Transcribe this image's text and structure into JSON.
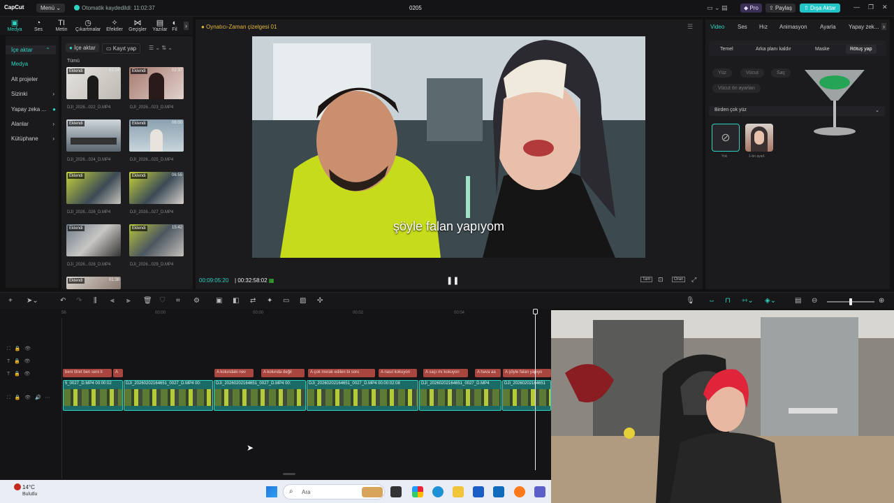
{
  "app": {
    "logo": "CapCut",
    "menu_label": "Menü",
    "autosave_text": "Otomatik kaydedildi: 11:02:37",
    "project_title": "0205",
    "pro_label": "Pro",
    "share_label": "Paylaş",
    "export_label": "Dışa Aktar"
  },
  "tools": [
    {
      "label": "Medya",
      "icon": "media-icon"
    },
    {
      "label": "Ses",
      "icon": "audio-icon"
    },
    {
      "label": "Metin",
      "icon": "text-icon"
    },
    {
      "label": "Çıkartmalar",
      "icon": "sticker-icon"
    },
    {
      "label": "Efektler",
      "icon": "effects-icon"
    },
    {
      "label": "Geçişler",
      "icon": "transitions-icon"
    },
    {
      "label": "Yazılar",
      "icon": "captions-icon"
    },
    {
      "label": "Fil",
      "icon": "filter-icon"
    }
  ],
  "sidebar": {
    "items": [
      "İçe aktar",
      "Medya",
      "Alt projeler",
      "Sizinki",
      "Yapay zeka ...",
      "Alanlar",
      "Kütüphane"
    ]
  },
  "media": {
    "import_label": "İçe aktar",
    "record_label": "Kayıt yap",
    "section_label": "Tümü",
    "items": [
      {
        "badge": "Eklendi",
        "duration": "01:24",
        "name": "DJI_2026...022_D.MP4"
      },
      {
        "badge": "Eklendi",
        "duration": "02:37",
        "name": "DJI_2026...023_D.MP4"
      },
      {
        "badge": "Eklendi",
        "duration": "",
        "name": "DJI_2026...024_D.MP4"
      },
      {
        "badge": "Eklendi",
        "duration": "06:00",
        "name": "DJI_2026...025_D.MP4"
      },
      {
        "badge": "Eklendi",
        "duration": "",
        "name": "DJI_2026...026_D.MP4"
      },
      {
        "badge": "Eklendi",
        "duration": "06:55",
        "name": "DJI_2026...027_D.MP4"
      },
      {
        "badge": "Eklendi",
        "duration": "",
        "name": "DJI_2026...028_D.MP4"
      },
      {
        "badge": "Eklendi",
        "duration": "15:42",
        "name": "DJI_2026...029_D.MP4"
      },
      {
        "badge": "Eklendi",
        "duration": "01:38",
        "name": ""
      }
    ]
  },
  "player": {
    "title": "Oynatıcı-Zaman çizelgesi 01",
    "subtitle": "şöyle falan yapıyom",
    "current_time": "00:09:05:20",
    "total_time": "00:32:58:02",
    "full_label": "Tam",
    "ratio_label": "Oran"
  },
  "inspector": {
    "tabs": [
      "Video",
      "Ses",
      "Hız",
      "Animasyon",
      "Ayarla",
      "Yapay zek..."
    ],
    "subtabs": [
      "Temel",
      "Arka planı kaldır",
      "Maske",
      "Rötuş yap"
    ],
    "pills": [
      "Yüz",
      "Vücut",
      "Saç",
      "Vücut ön ayarları"
    ],
    "select_value": "Birden çok yüz",
    "faces": [
      "Yok",
      "1-bn ayarl."
    ]
  },
  "timeline": {
    "ruler": [
      "56",
      "00:00",
      "00:00",
      "00:02",
      "00:04"
    ],
    "captions": [
      "beni titret ben seni ti",
      "A",
      "kolundaki nev",
      "kolunda değil",
      "çok merak edilen bi soru",
      "nasıl kokuyon",
      "saçı mı kokuyon",
      "hava aa",
      "şöyle falan yapıyo"
    ],
    "clips": [
      "5_0027_D.MP4  00:00:02",
      "DJI_20260202164651_0027_D.MP4  00:",
      "DJI_20260202164651_0027_D.MP4  00:00:02:08",
      "DJI_20260202164651_0027_D.MP4",
      "DJI_20260202164651"
    ]
  },
  "taskbar": {
    "temp": "14°C",
    "weather": "Bulutlu",
    "search_placeholder": "Ara"
  }
}
